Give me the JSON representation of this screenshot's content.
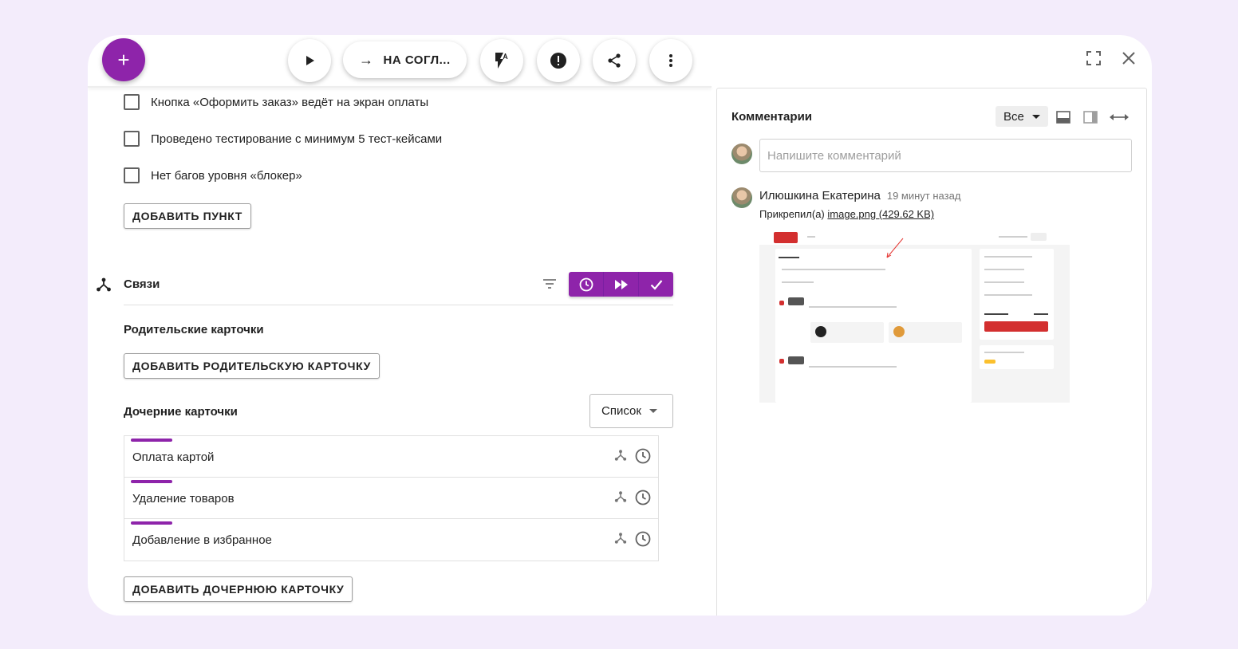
{
  "toolbar": {
    "add_label": "+",
    "status_label": "НА СОГЛ...",
    "status_arrow": "→"
  },
  "checklist": {
    "items": [
      "Кнопка «Оформить заказ» ведёт на экран оплаты",
      "Проведено тестирование с минимум 5 тест-кейсами",
      "Нет багов уровня «блокер»"
    ],
    "add_item_label": "ДОБАВИТЬ ПУНКТ"
  },
  "links": {
    "title": "Связи",
    "parents_title": "Родительские карточки",
    "add_parent_label": "ДОБАВИТЬ РОДИТЕЛЬСКУЮ КАРТОЧКУ",
    "children_title": "Дочерние карточки",
    "view_select": "Список",
    "children": [
      "Оплата картой",
      "Удаление товаров",
      "Добавление в избранное"
    ],
    "add_child_label": "ДОБАВИТЬ ДОЧЕРНЮЮ КАРТОЧКУ"
  },
  "comments": {
    "title": "Комментарии",
    "filter_value": "Все",
    "input_placeholder": "Напишите комментарий",
    "items": [
      {
        "author": "Илюшкина Екатерина",
        "time": "19 минут назад",
        "attach_prefix": "Прикрепил(а)",
        "attach_link": "image.png (429.62 KB)"
      }
    ]
  },
  "colors": {
    "accent": "#8e24aa",
    "background": "#f3ecfb"
  }
}
